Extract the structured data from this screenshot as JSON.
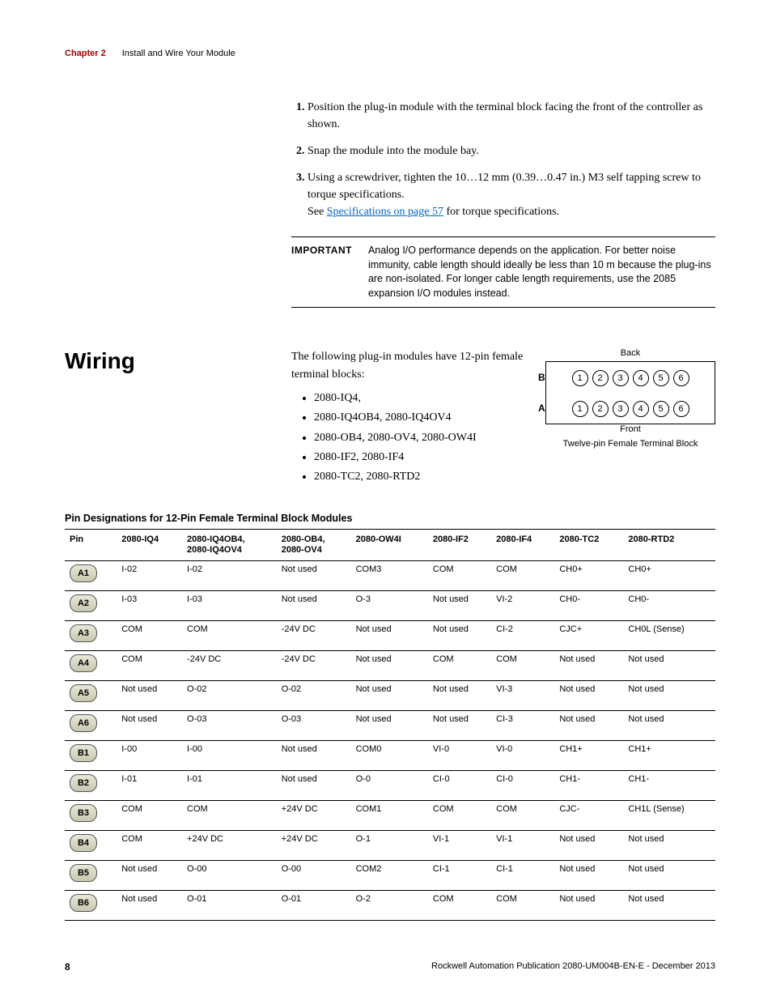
{
  "header": {
    "chapter_label": "Chapter 2",
    "chapter_title": "Install and Wire Your Module"
  },
  "instructions": {
    "items": [
      "Position the plug-in module with the terminal block facing the front of the controller as shown.",
      "Snap the module into the module bay.",
      "Using a screwdriver, tighten the 10…12 mm (0.39…0.47 in.) M3 self tapping screw to torque specifications."
    ],
    "see_prefix": "See ",
    "see_link": "Specifications on page 57",
    "see_suffix": " for torque specifications."
  },
  "important": {
    "label": "IMPORTANT",
    "text": "Analog I/O performance depends on the application. For better noise immunity, cable length should ideally be less than 10 m because the plug-ins are non-isolated. For longer cable length requirements, use the 2085 expansion I/O modules instead."
  },
  "wiring": {
    "heading": "Wiring",
    "intro": "The following plug-in modules have 12-pin female terminal blocks:",
    "bullets": [
      "2080-IQ4,",
      "2080-IQ4OB4, 2080-IQ4OV4",
      "2080-OB4, 2080-OV4, 2080-OW4I",
      "2080-IF2, 2080-IF4",
      "2080-TC2, 2080-RTD2"
    ]
  },
  "terminal_block": {
    "top": "Back",
    "bottom": "Front",
    "row_b": "B",
    "row_a": "A",
    "nums": [
      "1",
      "2",
      "3",
      "4",
      "5",
      "6"
    ],
    "caption": "Twelve-pin Female Terminal Block"
  },
  "table": {
    "caption": "Pin Designations for 12-Pin Female Terminal Block Modules",
    "headers": [
      "Pin",
      "2080-IQ4",
      "2080-IQ4OB4,\n2080-IQ4OV4",
      "2080-OB4,\n2080-OV4",
      "2080-OW4I",
      "2080-IF2",
      "2080-IF4",
      "2080-TC2",
      "2080-RTD2"
    ],
    "rows": [
      [
        "A1",
        "I-02",
        "I-02",
        "Not used",
        "COM3",
        "COM",
        "COM",
        "CH0+",
        "CH0+"
      ],
      [
        "A2",
        "I-03",
        "I-03",
        "Not used",
        "O-3",
        "Not used",
        "VI-2",
        "CH0-",
        "CH0-"
      ],
      [
        "A3",
        "COM",
        "COM",
        "-24V DC",
        "Not used",
        "Not used",
        "CI-2",
        "CJC+",
        "CH0L (Sense)"
      ],
      [
        "A4",
        "COM",
        "-24V DC",
        "-24V DC",
        "Not used",
        "COM",
        "COM",
        "Not used",
        "Not used"
      ],
      [
        "A5",
        "Not used",
        "O-02",
        "O-02",
        "Not used",
        "Not used",
        "VI-3",
        "Not used",
        "Not used"
      ],
      [
        "A6",
        "Not used",
        "O-03",
        "O-03",
        "Not used",
        "Not used",
        "CI-3",
        "Not used",
        "Not used"
      ],
      [
        "B1",
        "I-00",
        "I-00",
        "Not used",
        "COM0",
        "VI-0",
        "VI-0",
        "CH1+",
        "CH1+"
      ],
      [
        "B2",
        "I-01",
        "I-01",
        "Not used",
        "O-0",
        "CI-0",
        "CI-0",
        "CH1-",
        "CH1-"
      ],
      [
        "B3",
        "COM",
        "COM",
        "+24V DC",
        "COM1",
        "COM",
        "COM",
        "CJC-",
        "CH1L (Sense)"
      ],
      [
        "B4",
        "COM",
        "+24V DC",
        "+24V DC",
        "O-1",
        "VI-1",
        "VI-1",
        "Not used",
        "Not used"
      ],
      [
        "B5",
        "Not used",
        "O-00",
        "O-00",
        "COM2",
        "CI-1",
        "CI-1",
        "Not used",
        "Not used"
      ],
      [
        "B6",
        "Not used",
        "O-01",
        "O-01",
        "O-2",
        "COM",
        "COM",
        "Not used",
        "Not used"
      ]
    ]
  },
  "footer": {
    "page": "8",
    "pub": "Rockwell Automation Publication 2080-UM004B-EN-E - December 2013"
  }
}
